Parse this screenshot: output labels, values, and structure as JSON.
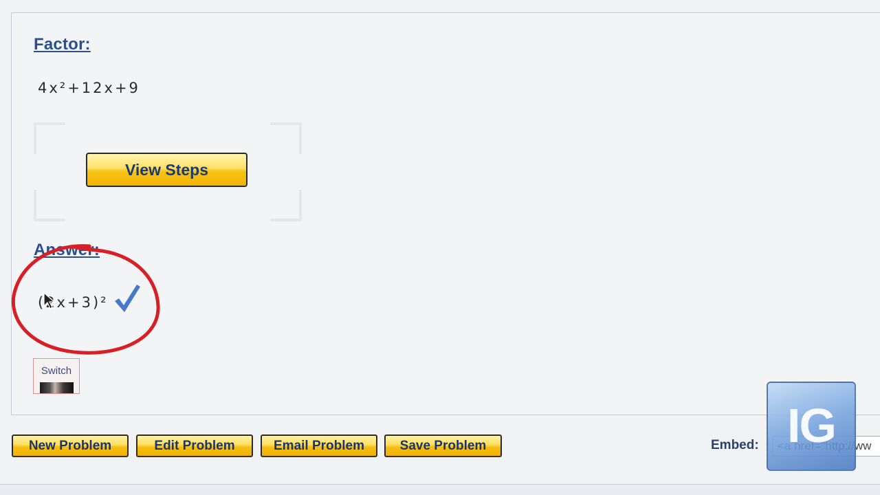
{
  "problem": {
    "heading": "Factor:",
    "expression": "4x²+12x+9"
  },
  "view_steps": {
    "label": "View Steps"
  },
  "answer": {
    "heading": "Answer:",
    "expression": "(2x+3)²"
  },
  "switch": {
    "label": "Switch"
  },
  "toolbar": {
    "new_label": "New Problem",
    "edit_label": "Edit Problem",
    "email_label": "Email Problem",
    "save_label": "Save Problem"
  },
  "embed": {
    "label": "Embed:",
    "value": "<a href=\"http://ww"
  },
  "watermark": {
    "text": "IG"
  },
  "colors": {
    "heading": "#2a4f8f",
    "button_yellow": "#f7c315",
    "check_blue": "#4a78c8",
    "annotation_red": "#d91f26"
  }
}
